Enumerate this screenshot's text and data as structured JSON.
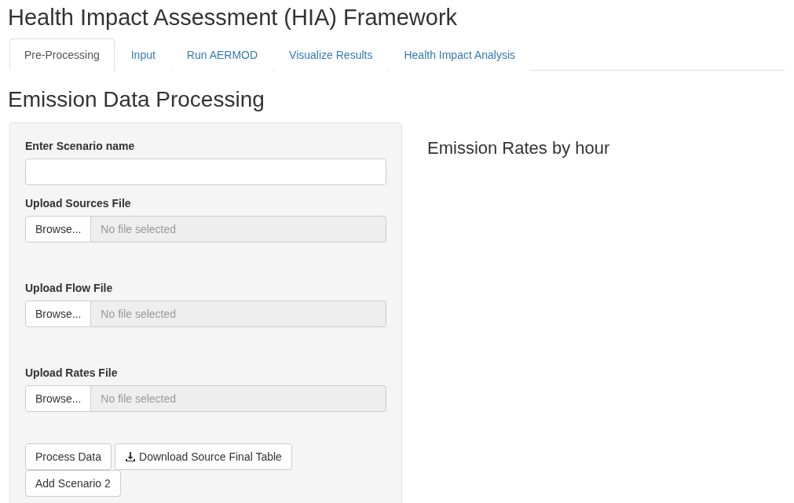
{
  "title": "Health Impact Assessment (HIA) Framework",
  "tabs": [
    {
      "label": "Pre-Processing",
      "selected": true
    },
    {
      "label": "Input",
      "selected": false
    },
    {
      "label": "Run AERMOD",
      "selected": false
    },
    {
      "label": "Visualize Results",
      "selected": false
    },
    {
      "label": "Health Impact Analysis",
      "selected": false
    }
  ],
  "section_title": "Emission Data Processing",
  "fields": [
    {
      "kind": "text",
      "label": "Enter Scenario name"
    },
    {
      "kind": "file",
      "label": "Upload Sources File",
      "button": "Browse...",
      "placeholder": "No file selected"
    },
    {
      "kind": "file",
      "label": "Upload Flow File",
      "button": "Browse...",
      "placeholder": "No file selected"
    },
    {
      "kind": "file",
      "label": "Upload Rates File",
      "button": "Browse...",
      "placeholder": "No file selected"
    }
  ],
  "buttons": [
    {
      "label": "Process Data",
      "kind": "plain"
    },
    {
      "label": "Download Source Final Table",
      "kind": "download"
    },
    {
      "label": "Add Scenario 2",
      "kind": "plain"
    }
  ],
  "output_title": "Emission Rates by hour"
}
